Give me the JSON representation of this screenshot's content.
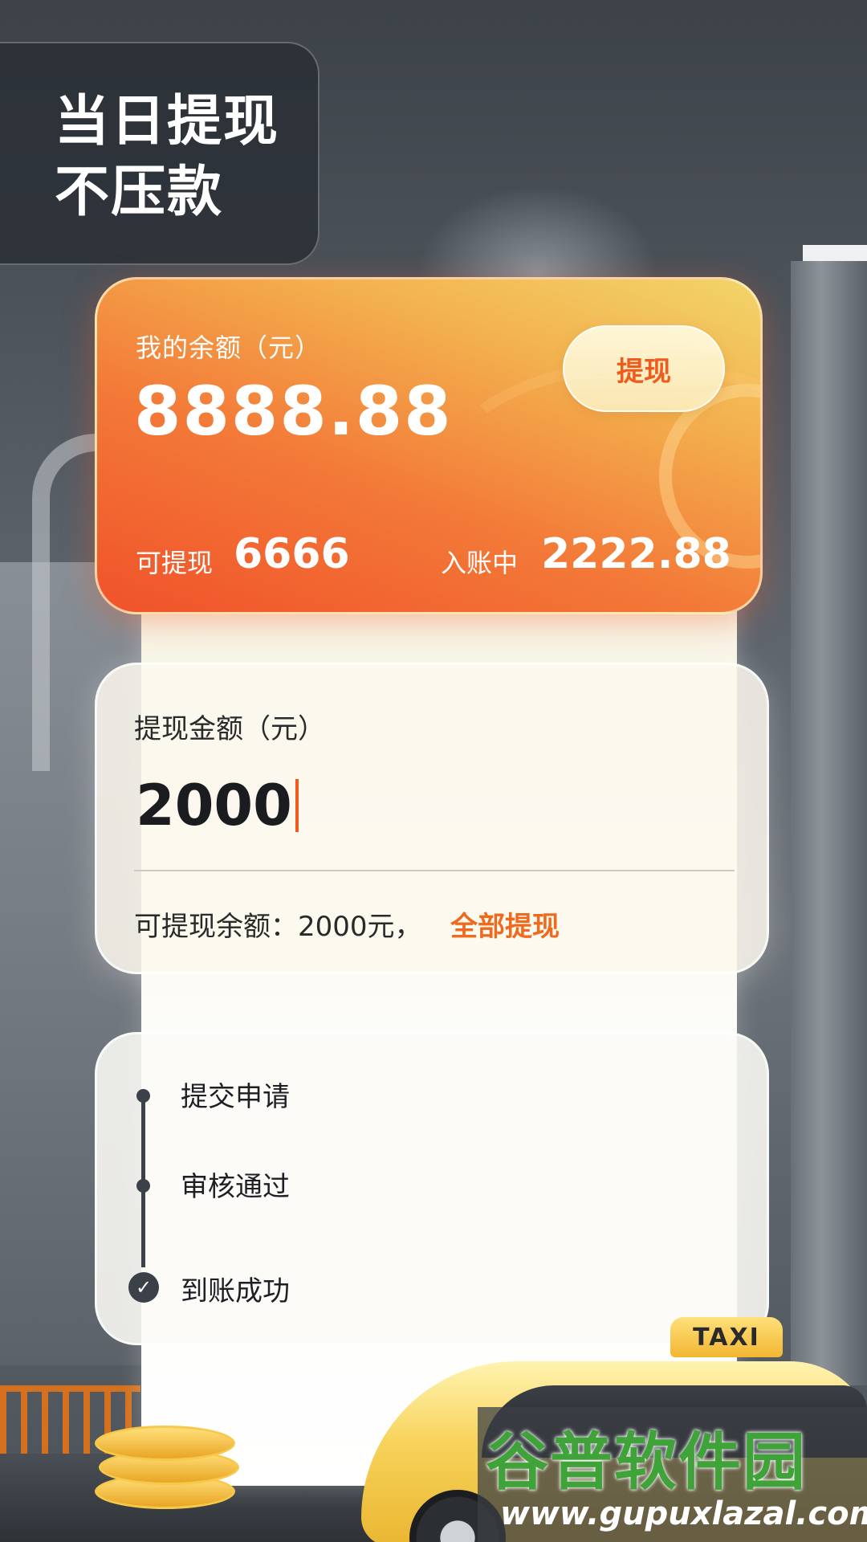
{
  "headline": {
    "line1": "当日提现",
    "line2": "不压款"
  },
  "balance_card": {
    "label": "我的余额（元）",
    "balance": "8888.88",
    "withdraw_button": "提现",
    "available_label": "可提现",
    "available_value": "6666",
    "pending_label": "入账中",
    "pending_value": "2222.88"
  },
  "amount_card": {
    "label": "提现金额（元）",
    "input_value": "2000",
    "available_note": "可提现余额：2000元，",
    "withdraw_all_link": "全部提现"
  },
  "steps": [
    {
      "label": "提交申请",
      "status": "dot"
    },
    {
      "label": "审核通过",
      "status": "dot"
    },
    {
      "label": "到账成功",
      "status": "check"
    }
  ],
  "decor": {
    "taxi_sign": "TAXI"
  },
  "watermark": {
    "name": "谷普软件园",
    "url": "www.gupuxlazal.com"
  },
  "colors": {
    "accent": "#ee5b1d",
    "card_gradient_start": "#f2d56a",
    "card_gradient_end": "#f0522a",
    "timeline": "#3c4049"
  },
  "icons": {
    "step_done": "check-circle-icon",
    "step_pending": "dot-icon"
  }
}
